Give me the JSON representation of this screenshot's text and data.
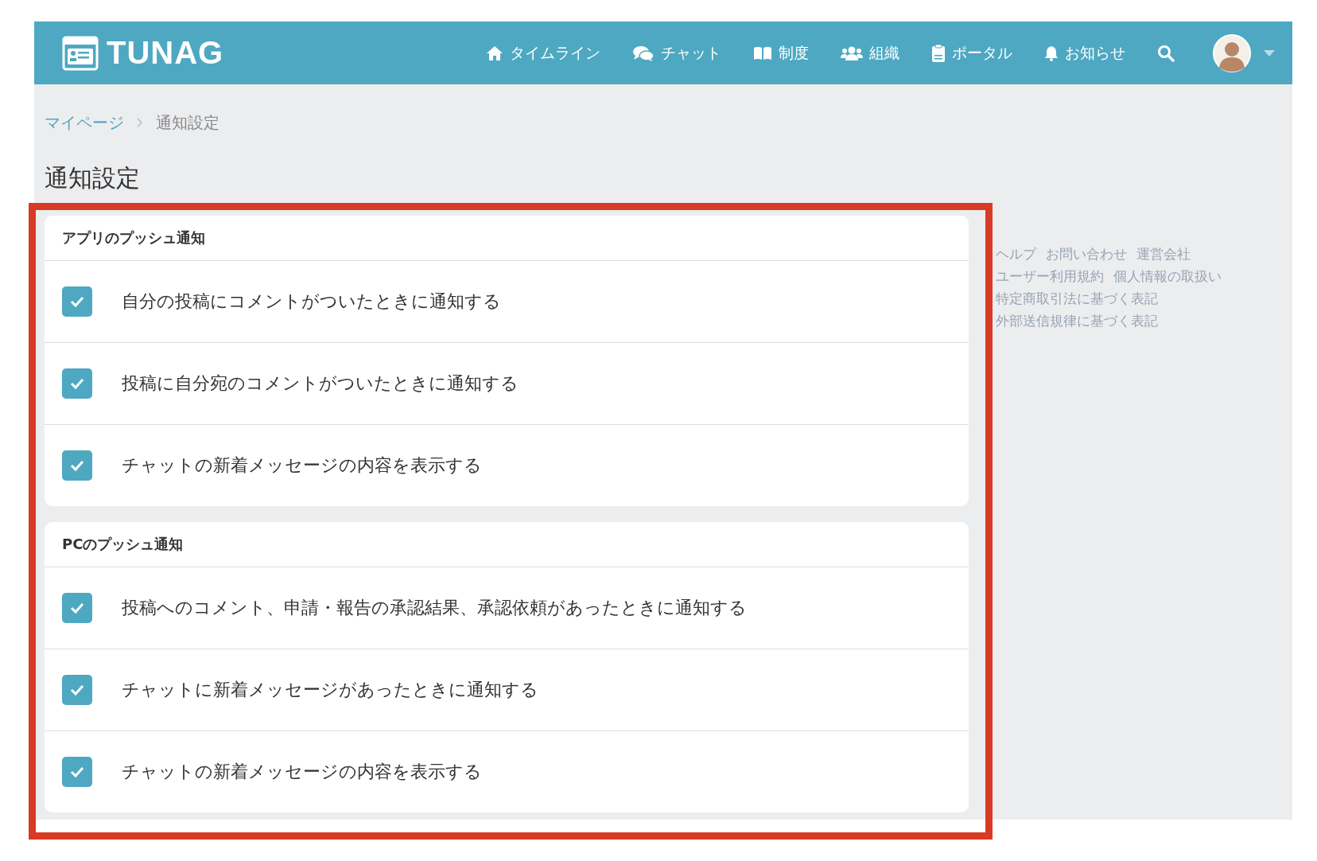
{
  "header": {
    "logo": "TUNAG",
    "nav": [
      {
        "label": "タイムライン"
      },
      {
        "label": "チャット"
      },
      {
        "label": "制度"
      },
      {
        "label": "組織"
      },
      {
        "label": "ポータル"
      },
      {
        "label": "お知らせ"
      }
    ]
  },
  "breadcrumb": [
    {
      "label": "マイページ",
      "kind": "link"
    },
    {
      "label": "通知設定",
      "kind": "current"
    }
  ],
  "page_title": "通知設定",
  "sections": [
    {
      "title": "アプリのプッシュ通知",
      "items": [
        {
          "label": "自分の投稿にコメントがついたときに通知する",
          "checked": true
        },
        {
          "label": "投稿に自分宛のコメントがついたときに通知する",
          "checked": true
        },
        {
          "label": "チャットの新着メッセージの内容を表示する",
          "checked": true
        }
      ]
    },
    {
      "title": "PCのプッシュ通知",
      "items": [
        {
          "label": "投稿へのコメント、申請・報告の承認結果、承認依頼があったときに通知する",
          "checked": true
        },
        {
          "label": "チャットに新着メッセージがあったときに通知する",
          "checked": true
        },
        {
          "label": "チャットの新着メッセージの内容を表示する",
          "checked": true
        }
      ]
    }
  ],
  "footer_links": [
    [
      "ヘルプ",
      "お問い合わせ",
      "運営会社"
    ],
    [
      "ユーザー利用規約",
      "個人情報の取扱い"
    ],
    [
      "特定商取引法に基づく表記"
    ],
    [
      "外部送信規律に基づく表記"
    ]
  ]
}
